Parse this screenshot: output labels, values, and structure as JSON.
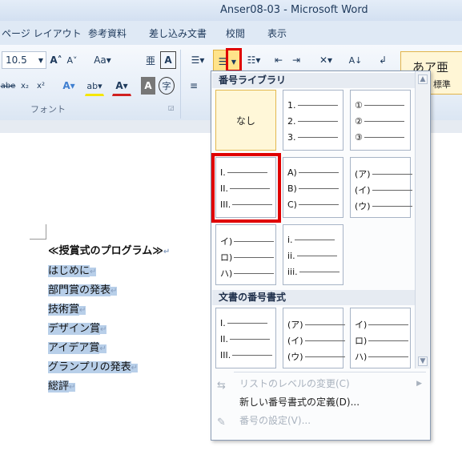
{
  "window": {
    "title": "Anser08-03 - Microsoft Word"
  },
  "tabs": [
    "ページ レイアウト",
    "参考資料",
    "差し込み文書",
    "校閲",
    "表示"
  ],
  "ribbon": {
    "font_size": "10.5",
    "font_group_label": "フォント",
    "style_sample": "あア亜",
    "style_name": "標準"
  },
  "document": {
    "lines": [
      {
        "text": "≪授賞式のプログラム≫",
        "bold": true,
        "highlight": false
      },
      {
        "text": "はじめに",
        "highlight": true
      },
      {
        "text": "部門賞の発表",
        "highlight": true
      },
      {
        "text": "技術賞",
        "highlight": true
      },
      {
        "text": "デザイン賞",
        "highlight": true
      },
      {
        "text": "アイデア賞",
        "highlight": true
      },
      {
        "text": "グランプリの発表",
        "highlight": true
      },
      {
        "text": "総評",
        "highlight": true
      }
    ],
    "para_mark": "↵"
  },
  "dropdown": {
    "library_header": "番号ライブラリ",
    "document_header": "文書の番号書式",
    "none_label": "なし",
    "library_tiles": [
      [
        "1.",
        "2.",
        "3."
      ],
      [
        "①",
        "②",
        "③"
      ],
      [
        "I.",
        "II.",
        "III."
      ],
      [
        "A)",
        "B)",
        "C)"
      ],
      [
        "(ア)",
        "(イ)",
        "(ウ)"
      ],
      [
        "イ)",
        "ロ)",
        "ハ)"
      ],
      [
        "i.",
        "ii.",
        "iii."
      ]
    ],
    "document_tiles": [
      [
        "I.",
        "II.",
        "III."
      ],
      [
        "(ア)",
        "(イ)",
        "(ウ)"
      ],
      [
        "イ)",
        "ロ)",
        "ハ)"
      ]
    ],
    "menu": {
      "change_level": "リストのレベルの変更(C)",
      "define_new": "新しい番号書式の定義(D)...",
      "set_value": "番号の設定(V)..."
    }
  }
}
